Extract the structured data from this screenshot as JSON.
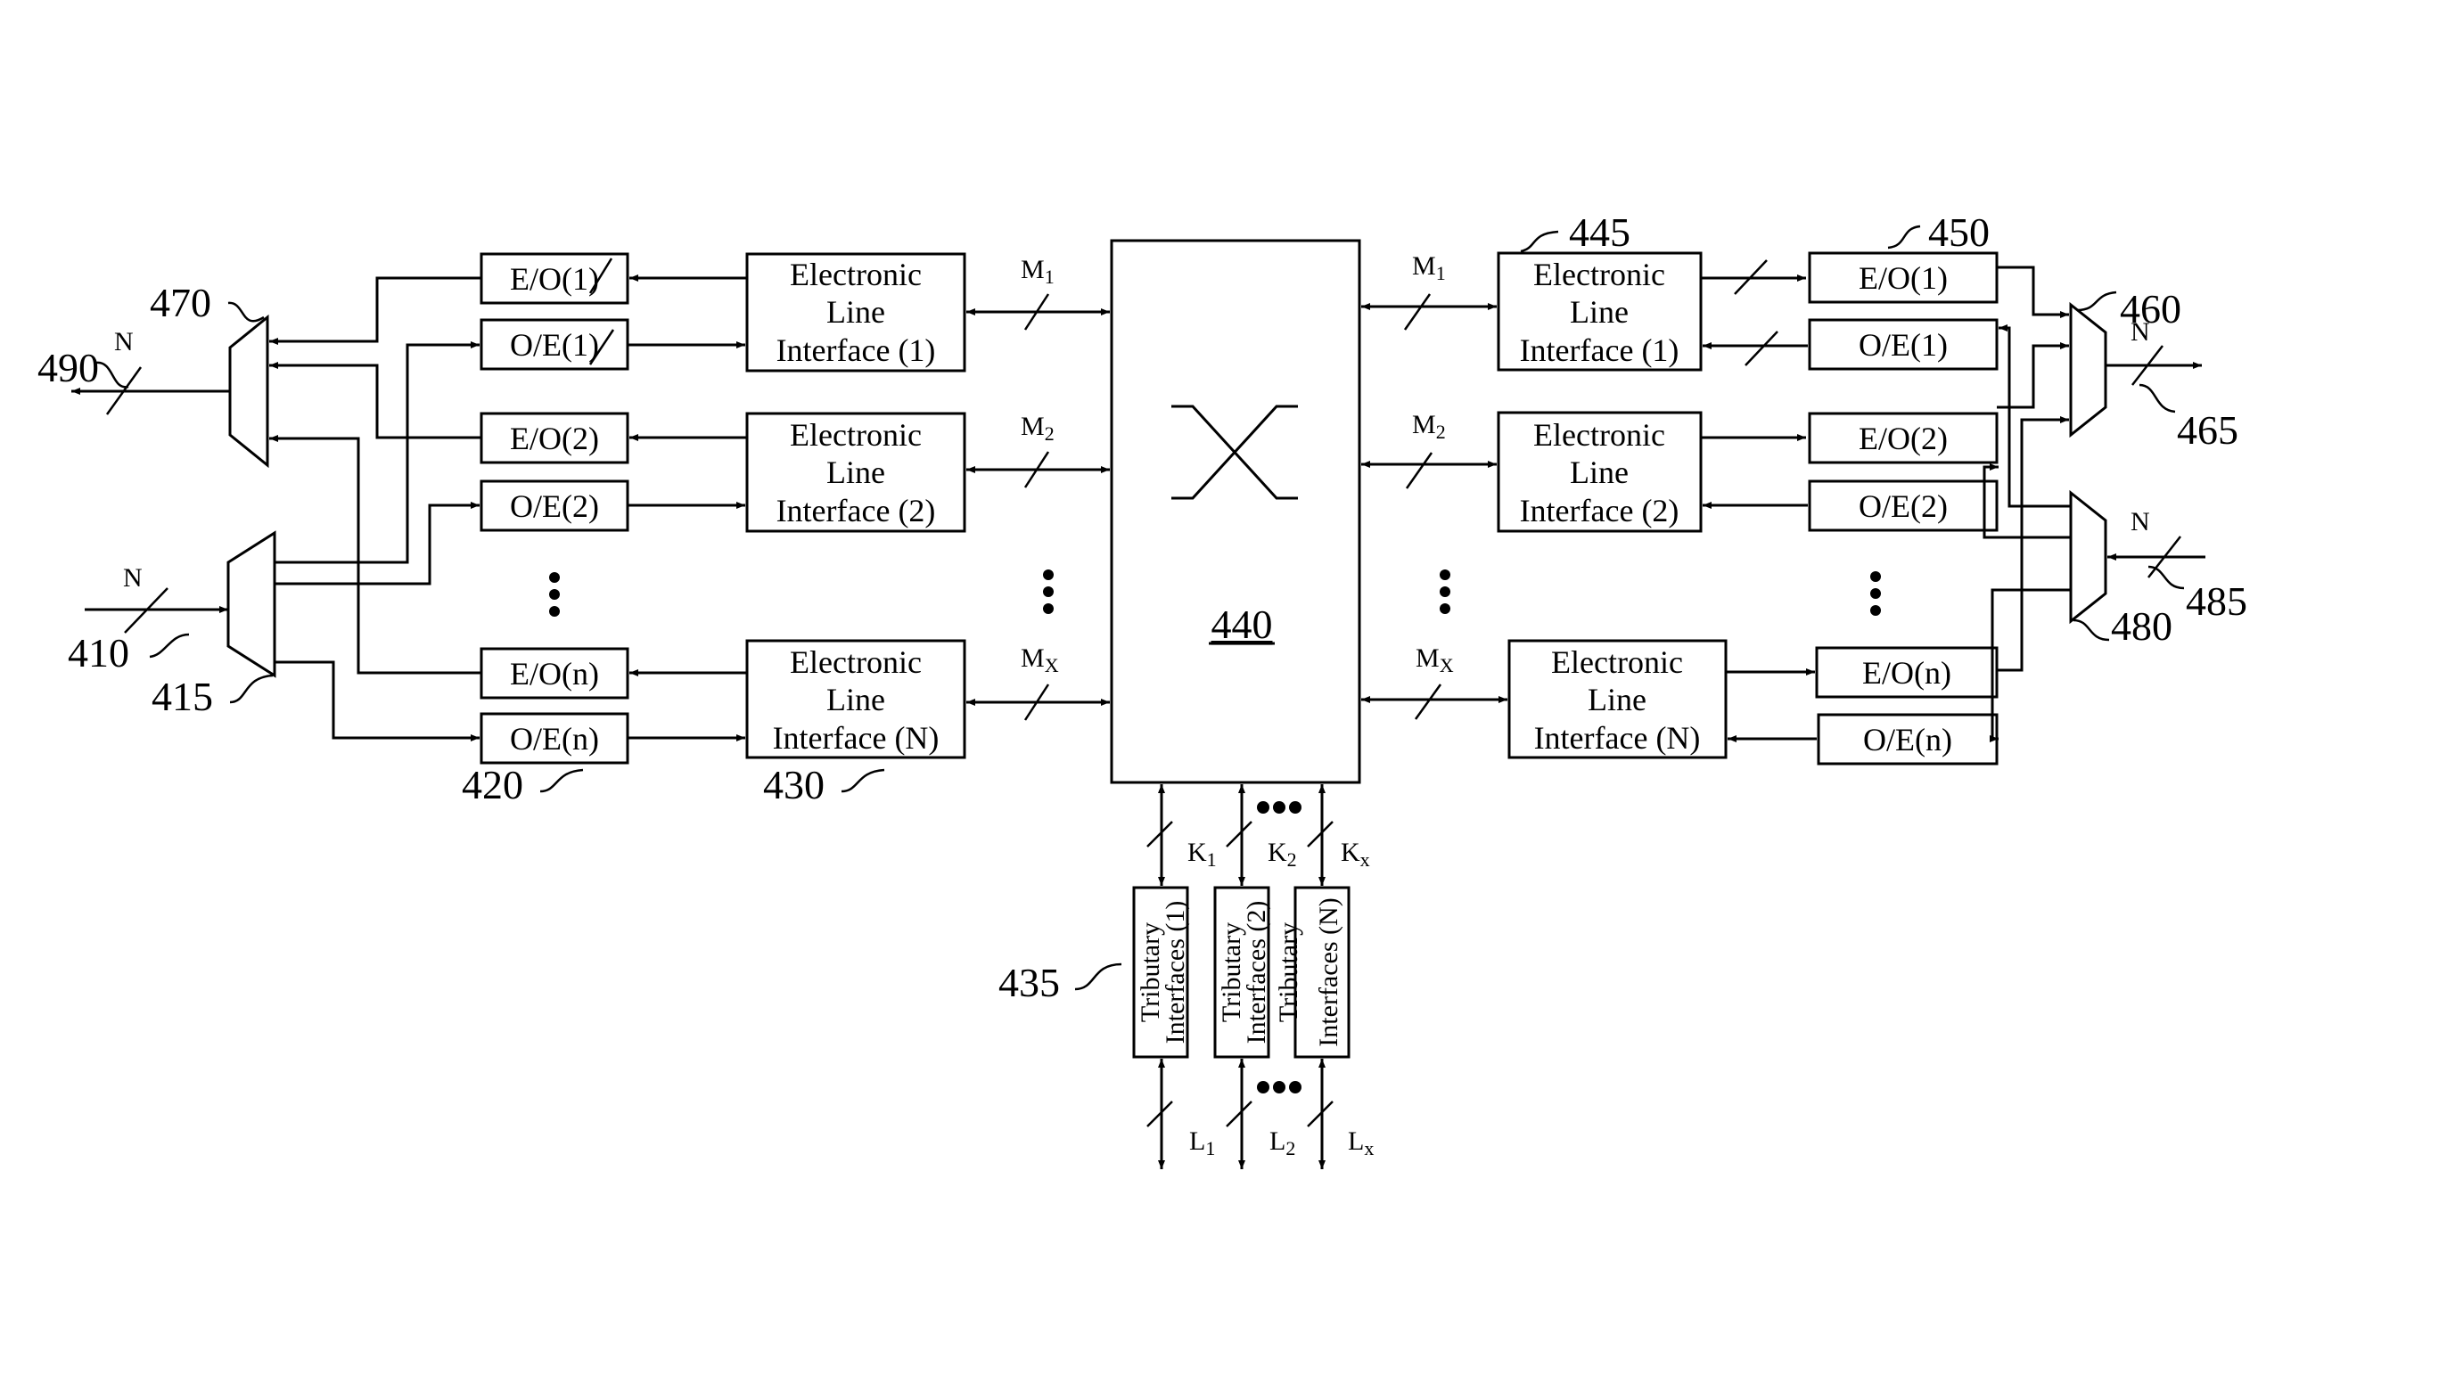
{
  "figure": {
    "switch": {
      "ref": "440"
    },
    "left": {
      "demux_in_ref": "415",
      "mux_out_ref": "470",
      "input_ref": "410",
      "output_ref": "490",
      "bus_width": "N",
      "converter_ref": "420",
      "eli_ref": "430",
      "eo": [
        "E/O(1)",
        "E/O(2)",
        "E/O(n)"
      ],
      "oe": [
        "O/E(1)",
        "O/E(2)",
        "O/E(n)"
      ],
      "eli": [
        [
          "Electronic",
          "Line",
          "Interface (1)"
        ],
        [
          "Electronic",
          "Line",
          "Interface (2)"
        ],
        [
          "Electronic",
          "Line",
          "Interface (N)"
        ]
      ],
      "m_labels": [
        [
          "M",
          "1"
        ],
        [
          "M",
          "2"
        ],
        [
          "M",
          "X"
        ]
      ]
    },
    "right": {
      "mux_out_ref": "460",
      "demux_in_ref": "480",
      "output_ref": "465",
      "input_ref": "485",
      "bus_width": "N",
      "converter_ref": "450",
      "eli_ref": "445",
      "eo": [
        "E/O(1)",
        "E/O(2)",
        "E/O(n)"
      ],
      "oe": [
        "O/E(1)",
        "O/E(2)",
        "O/E(n)"
      ],
      "eli": [
        [
          "Electronic",
          "Line",
          "Interface (1)"
        ],
        [
          "Electronic",
          "Line",
          "Interface (2)"
        ],
        [
          "Electronic",
          "Line",
          "Interface (N)"
        ]
      ],
      "m_labels": [
        [
          "M",
          "1"
        ],
        [
          "M",
          "2"
        ],
        [
          "M",
          "X"
        ]
      ]
    },
    "tributary": {
      "ref": "435",
      "blocks": [
        [
          "Tributary",
          "Interfaces (1)"
        ],
        [
          "Tributary",
          "Interfaces (2)"
        ],
        [
          "Tributary",
          "Interfaces (N)"
        ]
      ],
      "k_labels": [
        [
          "K",
          "1"
        ],
        [
          "K",
          "2"
        ],
        [
          "K",
          "x"
        ]
      ],
      "l_labels": [
        [
          "L",
          "1"
        ],
        [
          "L",
          "2"
        ],
        [
          "L",
          "x"
        ]
      ]
    }
  }
}
